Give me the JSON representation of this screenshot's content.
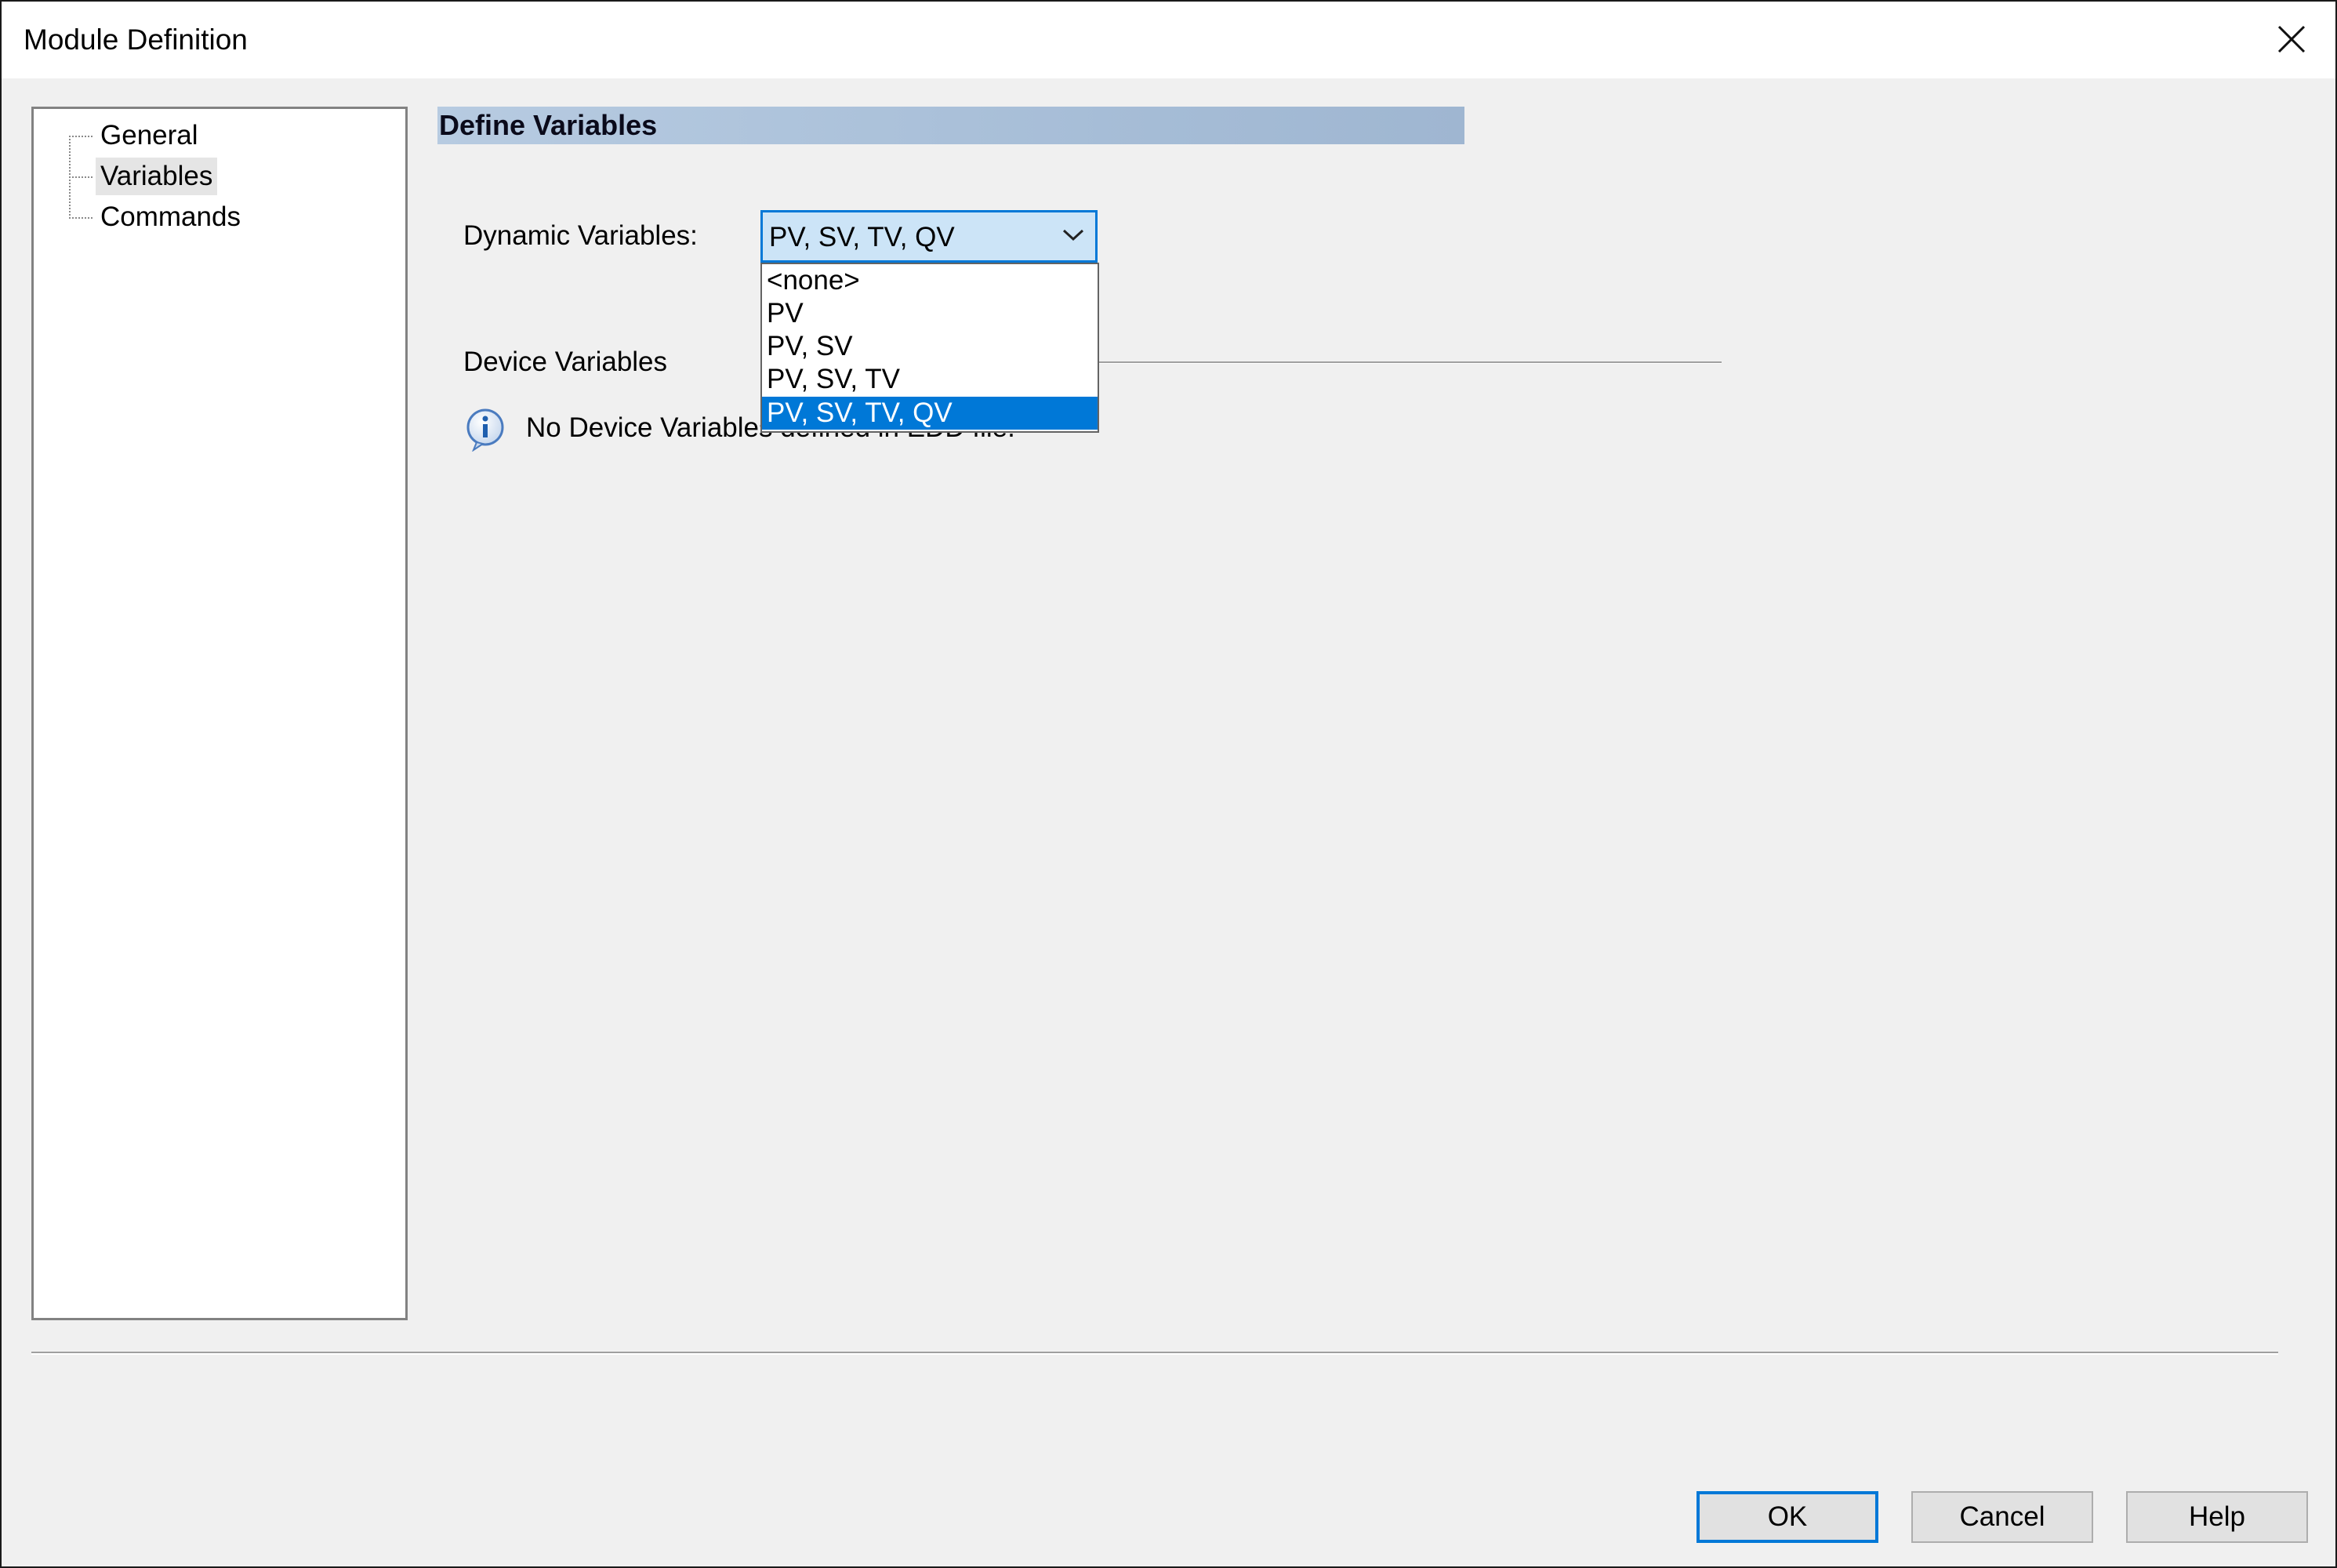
{
  "window": {
    "title": "Module Definition"
  },
  "tree": {
    "items": [
      {
        "label": "General"
      },
      {
        "label": "Variables",
        "selected": true
      },
      {
        "label": "Commands"
      }
    ]
  },
  "section": {
    "header": "Define Variables"
  },
  "dynamic_variables": {
    "label": "Dynamic Variables:",
    "selected_value": "PV, SV, TV, QV",
    "options": [
      "<none>",
      "PV",
      "PV, SV",
      "PV, SV, TV",
      "PV, SV, TV, QV"
    ],
    "highlighted_option": "PV, SV, TV, QV"
  },
  "device_variables": {
    "label": "Device Variables",
    "info_message": "No Device Variables defined in EDD file."
  },
  "buttons": {
    "ok": "OK",
    "cancel": "Cancel",
    "help": "Help"
  },
  "colors": {
    "accent": "#0078d7",
    "header_band": "#a5bcd6",
    "dialog_bg": "#f0f0f0"
  },
  "icons": {
    "close": "close-icon",
    "info": "info-icon",
    "dropdown": "chevron-down-icon"
  }
}
